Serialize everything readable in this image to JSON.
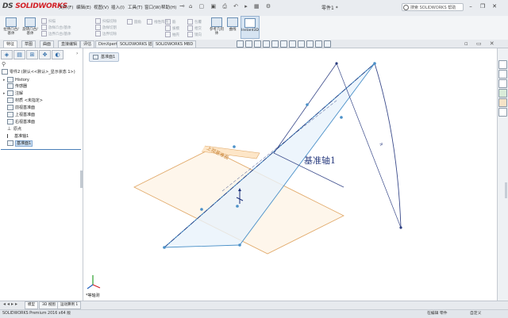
{
  "app": {
    "logo_brand": "DS",
    "logo_name": "SOLIDWORKS",
    "doc_title": "零件1 *"
  },
  "menu": [
    "文件(F)",
    "编辑(E)",
    "视图(V)",
    "插入(I)",
    "工具(T)",
    "窗口(W)",
    "帮助(H)"
  ],
  "search": {
    "placeholder": "搜索 SOLIDWORKS 帮助"
  },
  "command_manager": {
    "big_buttons": [
      "拉伸凸台/基体",
      "旋转凸台/基体",
      "参考几何体",
      "曲线",
      "Instant3D"
    ],
    "small_buttons": [
      "扫描",
      "放样凸台/基体",
      "边界凸台/基体",
      "扫描切除",
      "放样切割",
      "边界切除",
      "圆角",
      "线性阵列",
      "筋",
      "拔模",
      "抽壳",
      "包覆",
      "相交",
      "镜向"
    ]
  },
  "tabs": [
    "特征",
    "草图",
    "曲面",
    "直接编辑",
    "评估",
    "DimXpert",
    "SOLIDWORKS 插件",
    "SOLIDWORKS MBD"
  ],
  "active_tab": "特征",
  "feature_tree": {
    "root": "零件2 (默认<<默认>_显示状态 1>)",
    "items": [
      {
        "label": "History",
        "expander": "▸"
      },
      {
        "label": "传感器",
        "expander": ""
      },
      {
        "label": "注解",
        "expander": "▸"
      },
      {
        "label": "材质 <未指定>",
        "expander": ""
      },
      {
        "label": "前视基准面",
        "expander": ""
      },
      {
        "label": "上视基准面",
        "expander": ""
      },
      {
        "label": "右视基准面",
        "expander": ""
      },
      {
        "label": "原点",
        "expander": ""
      },
      {
        "label": "基准轴1",
        "expander": ""
      },
      {
        "label": "基准面1",
        "expander": "",
        "selected": true
      }
    ]
  },
  "graphics": {
    "flyout_label": "基准面1",
    "plane_label": "上视基准面",
    "axis_label": "基准轴1",
    "angle_mark": "R",
    "view_orientation": "*等轴测"
  },
  "bottom_tabs": [
    "模型",
    "3D 视图",
    "运动算例 1"
  ],
  "status": {
    "left": "SOLIDWORKS Premium 2016 x64 版",
    "mid": "在编辑 零件",
    "right": "自定义"
  },
  "colors": {
    "plane_blue": "#4a90c8",
    "plane_orange": "#e0a766",
    "axis_navy": "#2c3e80",
    "arc_navy": "#3a4a8a",
    "logo_red": "#d32027"
  }
}
